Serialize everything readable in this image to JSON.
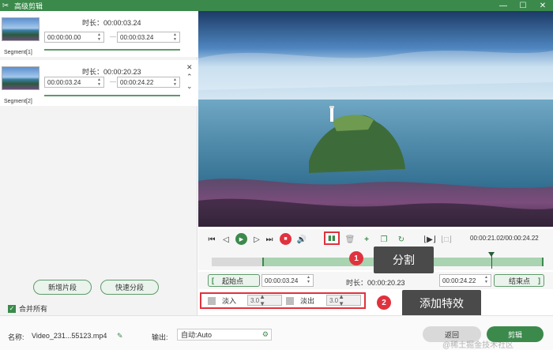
{
  "window": {
    "title": "高级剪辑",
    "minimize": "—",
    "maximize": "☐",
    "close": "✕"
  },
  "segments": [
    {
      "label": "Segment[1]",
      "duration": "时长：00:00:03.24",
      "start": "00:00:00.00",
      "end": "00:00:03.24",
      "separator": "—"
    },
    {
      "label": "Segment[2]",
      "duration": "时长：00:00:20.23",
      "start": "00:00:03.24",
      "end": "00:00:24.22",
      "separator": "—"
    }
  ],
  "left_buttons": {
    "add_segment": "新增片段",
    "quick_split": "快速分段",
    "merge_all": "合并所有"
  },
  "player": {
    "time_readout": "00:00:21.02/00:00:24.22",
    "progress_fraction": 0.84
  },
  "timeline": {
    "selection_start_fraction": 0.15,
    "selection_end_fraction": 1.0
  },
  "range": {
    "start_label": "起始点",
    "start_value": "00:00:03.24",
    "duration": "时长：00:00:20.23",
    "end_value": "00:00:24.22",
    "end_label": "结束点"
  },
  "fade": {
    "fade_in_label": "淡入",
    "fade_in_value": "3.0",
    "fade_out_label": "淡出",
    "fade_out_value": "3.0"
  },
  "annotations": [
    {
      "number": "1",
      "text": "分割"
    },
    {
      "number": "2",
      "text": "添加特效"
    }
  ],
  "bottom": {
    "name_label": "名称:",
    "name_value": "Video_231...55123.mp4",
    "output_label": "输出:",
    "output_value": "自动:Auto",
    "back_button": "返回",
    "cut_button": "剪辑"
  },
  "watermark": "@稀土掘金技术社区",
  "colors": {
    "accent": "#3b8a4c",
    "highlight": "#e0323e"
  }
}
